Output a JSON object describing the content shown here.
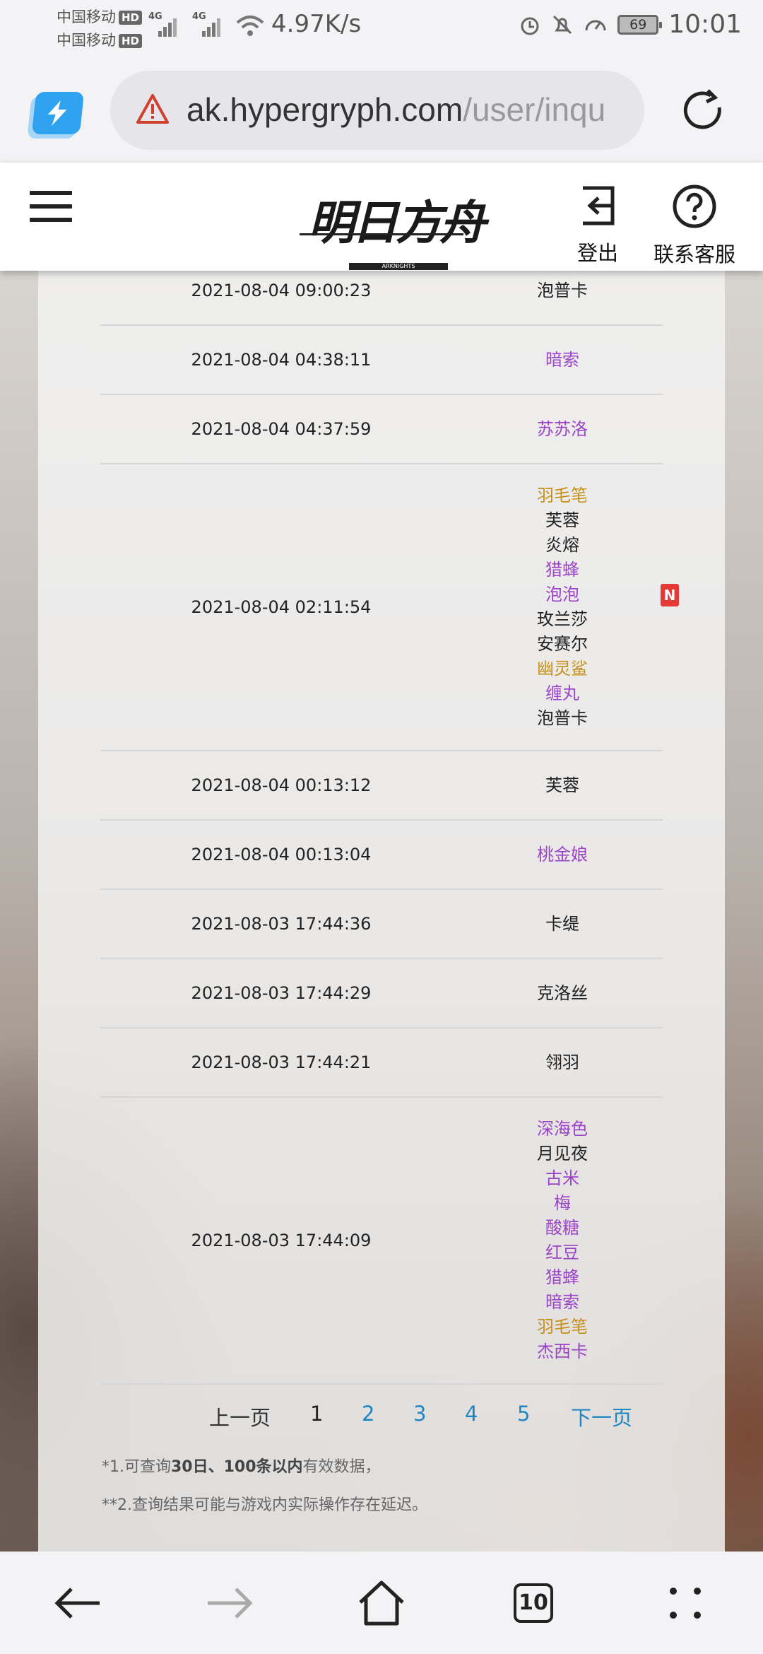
{
  "status_bar": {
    "carrier_1": "中国移动",
    "carrier_2": "中国移动",
    "hd_label": "HD",
    "net_type_1": "4G",
    "net_type_2": "4G",
    "net_speed": "4.97K/s",
    "battery": "69",
    "time": "10:01"
  },
  "browser": {
    "url_host": "ak.hypergryph.com",
    "url_path": "/user/inqu",
    "tabs_count": "10"
  },
  "header": {
    "logo_text": "明日方舟",
    "logo_sub": "ARKNIGHTS",
    "logout_label": "登出",
    "support_label": "联系客服"
  },
  "records": [
    {
      "time": "2021-08-04 09:00:23",
      "names": [
        {
          "name": "泡普卡",
          "rarity": "black"
        }
      ]
    },
    {
      "time": "2021-08-04 04:38:11",
      "names": [
        {
          "name": "暗索",
          "rarity": "purple"
        }
      ]
    },
    {
      "time": "2021-08-04 04:37:59",
      "names": [
        {
          "name": "苏苏洛",
          "rarity": "purple"
        }
      ]
    },
    {
      "time": "2021-08-04 02:11:54",
      "names": [
        {
          "name": "羽毛笔",
          "rarity": "gold"
        },
        {
          "name": "芙蓉",
          "rarity": "black"
        },
        {
          "name": "炎熔",
          "rarity": "black"
        },
        {
          "name": "猎蜂",
          "rarity": "purple"
        },
        {
          "name": "泡泡",
          "rarity": "purple",
          "new": "N"
        },
        {
          "name": "玫兰莎",
          "rarity": "black"
        },
        {
          "name": "安赛尔",
          "rarity": "black"
        },
        {
          "name": "幽灵鲨",
          "rarity": "gold"
        },
        {
          "name": "缠丸",
          "rarity": "purple"
        },
        {
          "name": "泡普卡",
          "rarity": "black"
        }
      ]
    },
    {
      "time": "2021-08-04 00:13:12",
      "names": [
        {
          "name": "芙蓉",
          "rarity": "black"
        }
      ]
    },
    {
      "time": "2021-08-04 00:13:04",
      "names": [
        {
          "name": "桃金娘",
          "rarity": "purple"
        }
      ]
    },
    {
      "time": "2021-08-03 17:44:36",
      "names": [
        {
          "name": "卡缇",
          "rarity": "black"
        }
      ]
    },
    {
      "time": "2021-08-03 17:44:29",
      "names": [
        {
          "name": "克洛丝",
          "rarity": "black"
        }
      ]
    },
    {
      "time": "2021-08-03 17:44:21",
      "names": [
        {
          "name": "翎羽",
          "rarity": "black"
        }
      ]
    },
    {
      "time": "2021-08-03 17:44:09",
      "names": [
        {
          "name": "深海色",
          "rarity": "purple"
        },
        {
          "name": "月见夜",
          "rarity": "black"
        },
        {
          "name": "古米",
          "rarity": "purple"
        },
        {
          "name": "梅",
          "rarity": "purple"
        },
        {
          "name": "酸糖",
          "rarity": "purple"
        },
        {
          "name": "红豆",
          "rarity": "purple"
        },
        {
          "name": "猎蜂",
          "rarity": "purple"
        },
        {
          "name": "暗索",
          "rarity": "purple"
        },
        {
          "name": "羽毛笔",
          "rarity": "gold"
        },
        {
          "name": "杰西卡",
          "rarity": "purple"
        }
      ]
    }
  ],
  "colors": {
    "purple": "#9b44c8",
    "gold": "#c7901c",
    "black": "#222222",
    "link": "#1f86c4"
  },
  "pager": {
    "prev": "上一页",
    "current": "1",
    "pages": [
      "2",
      "3",
      "4",
      "5"
    ],
    "next": "下一页"
  },
  "notes": {
    "note1_prefix": "*1.可查询",
    "note1_bold": "30日、100条以内",
    "note1_suffix": "有效数据，",
    "note2": "**2.查询结果可能与游戏内实际操作存在延迟。"
  }
}
